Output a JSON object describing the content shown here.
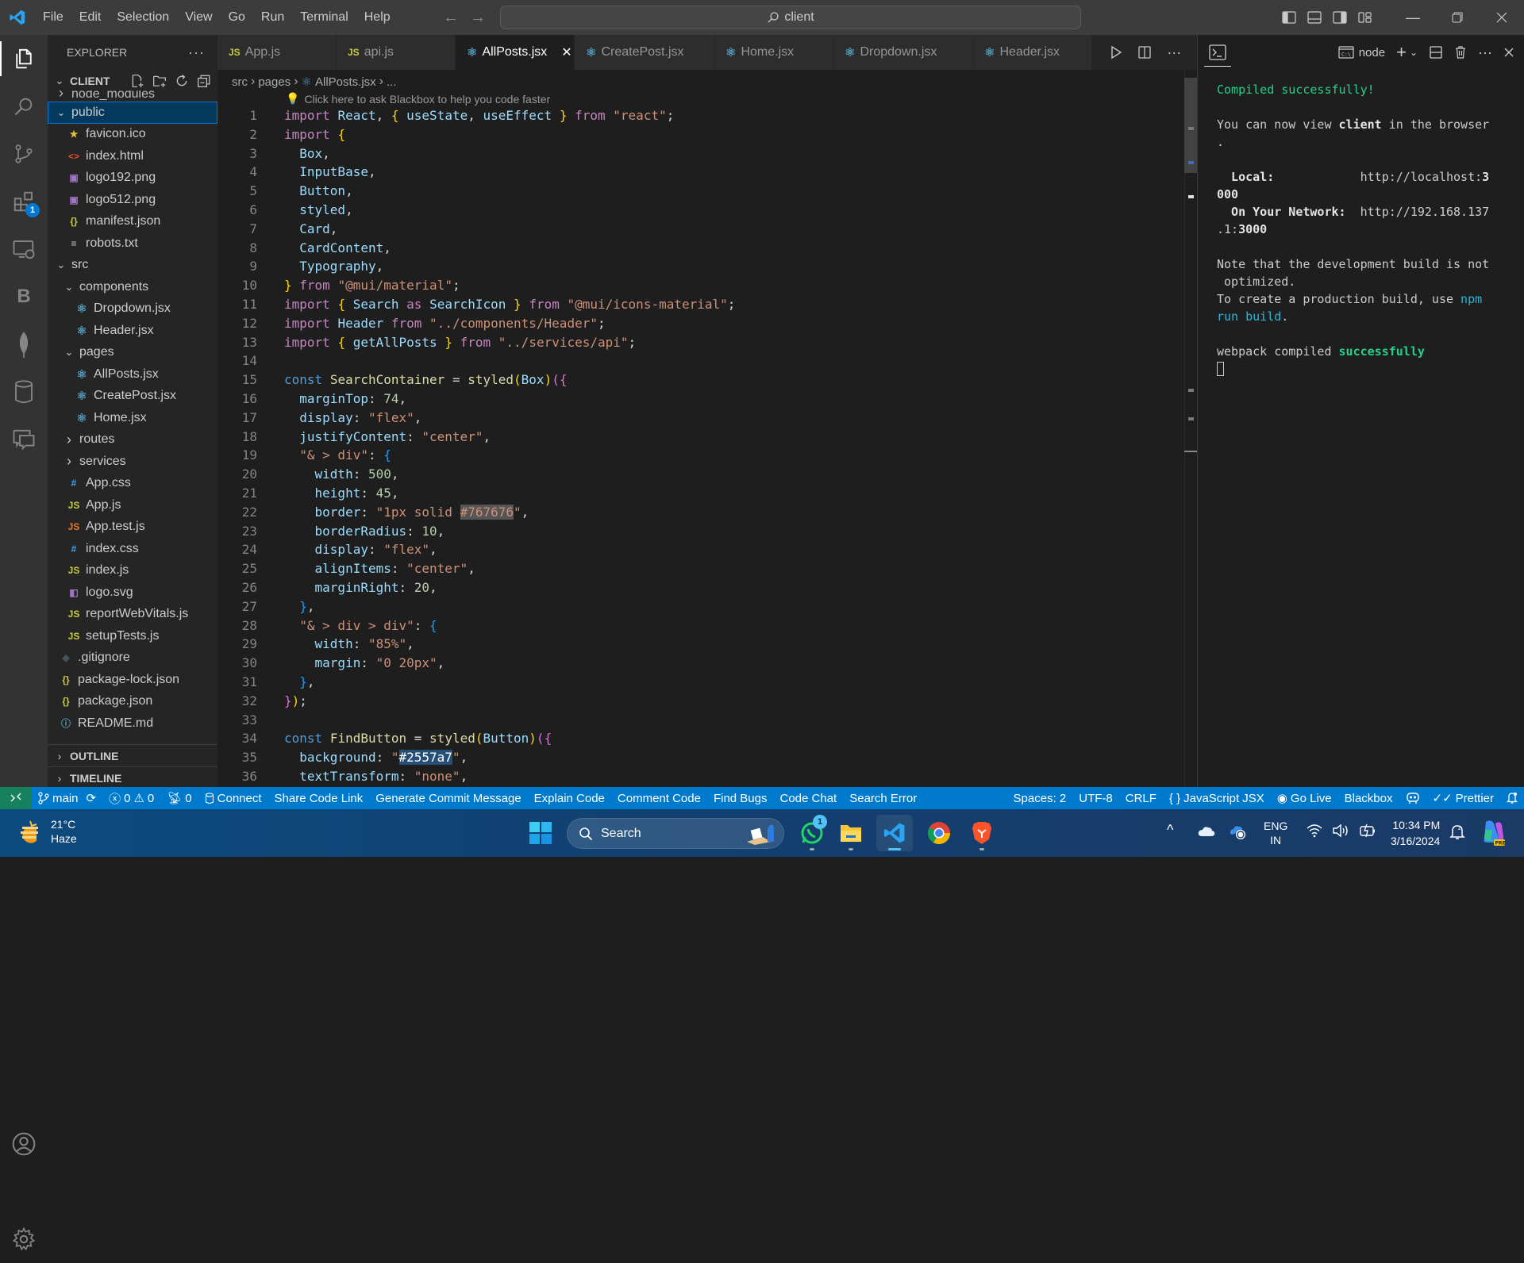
{
  "titlebar": {
    "menu": [
      "File",
      "Edit",
      "Selection",
      "View",
      "Go",
      "Run",
      "Terminal",
      "Help"
    ],
    "command_center": "client",
    "window_controls": [
      "minimize",
      "restore",
      "close"
    ]
  },
  "activity_bar": {
    "items": [
      {
        "name": "explorer",
        "active": true
      },
      {
        "name": "search"
      },
      {
        "name": "source-control"
      },
      {
        "name": "extensions",
        "badge": "1"
      },
      {
        "name": "remote-explorer"
      },
      {
        "name": "blackbox",
        "glyph": "B"
      },
      {
        "name": "mongodb"
      },
      {
        "name": "database"
      },
      {
        "name": "chat"
      }
    ],
    "bottom": [
      "accounts",
      "manage"
    ]
  },
  "sidebar": {
    "title": "EXPLORER",
    "section": "CLIENT",
    "tree": [
      {
        "label": "node_modules",
        "type": "folder",
        "depth": 1,
        "open": false,
        "cut": true
      },
      {
        "label": "public",
        "type": "folder",
        "depth": 1,
        "open": true,
        "selected": true
      },
      {
        "label": "favicon.ico",
        "type": "ico",
        "depth": 2
      },
      {
        "label": "index.html",
        "type": "html",
        "depth": 2
      },
      {
        "label": "logo192.png",
        "type": "png",
        "depth": 2
      },
      {
        "label": "logo512.png",
        "type": "png",
        "depth": 2
      },
      {
        "label": "manifest.json",
        "type": "json",
        "depth": 2
      },
      {
        "label": "robots.txt",
        "type": "txt",
        "depth": 2
      },
      {
        "label": "src",
        "type": "folder",
        "depth": 1,
        "open": true
      },
      {
        "label": "components",
        "type": "folder",
        "depth": 2,
        "open": true
      },
      {
        "label": "Dropdown.jsx",
        "type": "jsx",
        "depth": 3
      },
      {
        "label": "Header.jsx",
        "type": "jsx",
        "depth": 3
      },
      {
        "label": "pages",
        "type": "folder",
        "depth": 2,
        "open": true
      },
      {
        "label": "AllPosts.jsx",
        "type": "jsx",
        "depth": 3
      },
      {
        "label": "CreatePost.jsx",
        "type": "jsx",
        "depth": 3
      },
      {
        "label": "Home.jsx",
        "type": "jsx",
        "depth": 3
      },
      {
        "label": "routes",
        "type": "folder",
        "depth": 2,
        "open": false
      },
      {
        "label": "services",
        "type": "folder",
        "depth": 2,
        "open": false
      },
      {
        "label": "App.css",
        "type": "css",
        "depth": 2
      },
      {
        "label": "App.js",
        "type": "js",
        "depth": 2
      },
      {
        "label": "App.test.js",
        "type": "test",
        "depth": 2
      },
      {
        "label": "index.css",
        "type": "css",
        "depth": 2
      },
      {
        "label": "index.js",
        "type": "js",
        "depth": 2
      },
      {
        "label": "logo.svg",
        "type": "svg",
        "depth": 2
      },
      {
        "label": "reportWebVitals.js",
        "type": "js",
        "depth": 2
      },
      {
        "label": "setupTests.js",
        "type": "js",
        "depth": 2
      },
      {
        "label": ".gitignore",
        "type": "git",
        "depth": 1
      },
      {
        "label": "package-lock.json",
        "type": "json",
        "depth": 1
      },
      {
        "label": "package.json",
        "type": "json",
        "depth": 1
      },
      {
        "label": "README.md",
        "type": "info",
        "depth": 1
      }
    ],
    "outline": "OUTLINE",
    "timeline": "TIMELINE"
  },
  "editor": {
    "tabs": [
      {
        "label": "App.js",
        "type": "js"
      },
      {
        "label": "api.js",
        "type": "js"
      },
      {
        "label": "AllPosts.jsx",
        "type": "jsx",
        "active": true
      },
      {
        "label": "CreatePost.jsx",
        "type": "jsx"
      },
      {
        "label": "Home.jsx",
        "type": "jsx"
      },
      {
        "label": "Dropdown.jsx",
        "type": "jsx"
      },
      {
        "label": "Header.jsx",
        "type": "jsx"
      }
    ],
    "breadcrumb": [
      "src",
      "pages",
      "AllPosts.jsx",
      "..."
    ],
    "codelens": "Click here to ask Blackbox to help you code faster",
    "lines": [
      [
        [
          "kw",
          "import"
        ],
        [
          "pn",
          " "
        ],
        [
          "id",
          "React"
        ],
        [
          "pn",
          ", "
        ],
        [
          "b1",
          "{"
        ],
        [
          "pn",
          " "
        ],
        [
          "id",
          "useState"
        ],
        [
          "pn",
          ", "
        ],
        [
          "id",
          "useEffect"
        ],
        [
          "pn",
          " "
        ],
        [
          "b1",
          "}"
        ],
        [
          "pn",
          " "
        ],
        [
          "kw",
          "from"
        ],
        [
          "pn",
          " "
        ],
        [
          "st",
          "\"react\""
        ],
        [
          "pn",
          ";"
        ]
      ],
      [
        [
          "kw",
          "import"
        ],
        [
          "pn",
          " "
        ],
        [
          "b1",
          "{"
        ]
      ],
      [
        [
          "pn",
          "  "
        ],
        [
          "id",
          "Box"
        ],
        [
          "pn",
          ","
        ]
      ],
      [
        [
          "pn",
          "  "
        ],
        [
          "id",
          "InputBase"
        ],
        [
          "pn",
          ","
        ]
      ],
      [
        [
          "pn",
          "  "
        ],
        [
          "id",
          "Button"
        ],
        [
          "pn",
          ","
        ]
      ],
      [
        [
          "pn",
          "  "
        ],
        [
          "id",
          "styled"
        ],
        [
          "pn",
          ","
        ]
      ],
      [
        [
          "pn",
          "  "
        ],
        [
          "id",
          "Card"
        ],
        [
          "pn",
          ","
        ]
      ],
      [
        [
          "pn",
          "  "
        ],
        [
          "id",
          "CardContent"
        ],
        [
          "pn",
          ","
        ]
      ],
      [
        [
          "pn",
          "  "
        ],
        [
          "id",
          "Typography"
        ],
        [
          "pn",
          ","
        ]
      ],
      [
        [
          "b1",
          "}"
        ],
        [
          "pn",
          " "
        ],
        [
          "kw",
          "from"
        ],
        [
          "pn",
          " "
        ],
        [
          "st",
          "\"@mui/material\""
        ],
        [
          "pn",
          ";"
        ]
      ],
      [
        [
          "kw",
          "import"
        ],
        [
          "pn",
          " "
        ],
        [
          "b1",
          "{"
        ],
        [
          "pn",
          " "
        ],
        [
          "id",
          "Search"
        ],
        [
          "pn",
          " "
        ],
        [
          "kw",
          "as"
        ],
        [
          "pn",
          " "
        ],
        [
          "id",
          "SearchIcon"
        ],
        [
          "pn",
          " "
        ],
        [
          "b1",
          "}"
        ],
        [
          "pn",
          " "
        ],
        [
          "kw",
          "from"
        ],
        [
          "pn",
          " "
        ],
        [
          "st",
          "\"@mui/icons-material\""
        ],
        [
          "pn",
          ";"
        ]
      ],
      [
        [
          "kw",
          "import"
        ],
        [
          "pn",
          " "
        ],
        [
          "id",
          "Header"
        ],
        [
          "pn",
          " "
        ],
        [
          "kw",
          "from"
        ],
        [
          "pn",
          " "
        ],
        [
          "st",
          "\"../components/Header\""
        ],
        [
          "pn",
          ";"
        ]
      ],
      [
        [
          "kw",
          "import"
        ],
        [
          "pn",
          " "
        ],
        [
          "b1",
          "{"
        ],
        [
          "pn",
          " "
        ],
        [
          "id",
          "getAllPosts"
        ],
        [
          "pn",
          " "
        ],
        [
          "b1",
          "}"
        ],
        [
          "pn",
          " "
        ],
        [
          "kw",
          "from"
        ],
        [
          "pn",
          " "
        ],
        [
          "st",
          "\"../services/api\""
        ],
        [
          "pn",
          ";"
        ]
      ],
      [],
      [
        [
          "kb",
          "const"
        ],
        [
          "pn",
          " "
        ],
        [
          "fn",
          "SearchContainer"
        ],
        [
          "pn",
          " = "
        ],
        [
          "fn",
          "styled"
        ],
        [
          "b1",
          "("
        ],
        [
          "id",
          "Box"
        ],
        [
          "b1",
          ")"
        ],
        [
          "b2",
          "("
        ],
        [
          "b2",
          "{"
        ]
      ],
      [
        [
          "pn",
          "  "
        ],
        [
          "id",
          "marginTop"
        ],
        [
          "pn",
          ": "
        ],
        [
          "nm",
          "74"
        ],
        [
          "pn",
          ","
        ]
      ],
      [
        [
          "pn",
          "  "
        ],
        [
          "id",
          "display"
        ],
        [
          "pn",
          ": "
        ],
        [
          "st",
          "\"flex\""
        ],
        [
          "pn",
          ","
        ]
      ],
      [
        [
          "pn",
          "  "
        ],
        [
          "id",
          "justifyContent"
        ],
        [
          "pn",
          ": "
        ],
        [
          "st",
          "\"center\""
        ],
        [
          "pn",
          ","
        ]
      ],
      [
        [
          "pn",
          "  "
        ],
        [
          "st",
          "\"& > div\""
        ],
        [
          "pn",
          ": "
        ],
        [
          "b3",
          "{"
        ]
      ],
      [
        [
          "pn",
          "    "
        ],
        [
          "id",
          "width"
        ],
        [
          "pn",
          ": "
        ],
        [
          "nm",
          "500"
        ],
        [
          "pn",
          ","
        ]
      ],
      [
        [
          "pn",
          "    "
        ],
        [
          "id",
          "height"
        ],
        [
          "pn",
          ": "
        ],
        [
          "nm",
          "45"
        ],
        [
          "pn",
          ","
        ]
      ],
      [
        [
          "pn",
          "    "
        ],
        [
          "id",
          "border"
        ],
        [
          "pn",
          ": "
        ],
        [
          "st",
          "\"1px solid "
        ],
        [
          "st hl-gray",
          "#767676"
        ],
        [
          "st",
          "\""
        ],
        [
          "pn",
          ","
        ]
      ],
      [
        [
          "pn",
          "    "
        ],
        [
          "id",
          "borderRadius"
        ],
        [
          "pn",
          ": "
        ],
        [
          "nm",
          "10"
        ],
        [
          "pn",
          ","
        ]
      ],
      [
        [
          "pn",
          "    "
        ],
        [
          "id",
          "display"
        ],
        [
          "pn",
          ": "
        ],
        [
          "st",
          "\"flex\""
        ],
        [
          "pn",
          ","
        ]
      ],
      [
        [
          "pn",
          "    "
        ],
        [
          "id",
          "alignItems"
        ],
        [
          "pn",
          ": "
        ],
        [
          "st",
          "\"center\""
        ],
        [
          "pn",
          ","
        ]
      ],
      [
        [
          "pn",
          "    "
        ],
        [
          "id",
          "marginRight"
        ],
        [
          "pn",
          ": "
        ],
        [
          "nm",
          "20"
        ],
        [
          "pn",
          ","
        ]
      ],
      [
        [
          "pn",
          "  "
        ],
        [
          "b3",
          "}"
        ],
        [
          "pn",
          ","
        ]
      ],
      [
        [
          "pn",
          "  "
        ],
        [
          "st",
          "\"& > div > div\""
        ],
        [
          "pn",
          ": "
        ],
        [
          "b3",
          "{"
        ]
      ],
      [
        [
          "pn",
          "    "
        ],
        [
          "id",
          "width"
        ],
        [
          "pn",
          ": "
        ],
        [
          "st",
          "\"85%\""
        ],
        [
          "pn",
          ","
        ]
      ],
      [
        [
          "pn",
          "    "
        ],
        [
          "id",
          "margin"
        ],
        [
          "pn",
          ": "
        ],
        [
          "st",
          "\"0 20px\""
        ],
        [
          "pn",
          ","
        ]
      ],
      [
        [
          "pn",
          "  "
        ],
        [
          "b3",
          "}"
        ],
        [
          "pn",
          ","
        ]
      ],
      [
        [
          "b2",
          "}"
        ],
        [
          "b1",
          ")"
        ],
        [
          "pn",
          ";"
        ]
      ],
      [],
      [
        [
          "kb",
          "const"
        ],
        [
          "pn",
          " "
        ],
        [
          "fn",
          "FindButton"
        ],
        [
          "pn",
          " = "
        ],
        [
          "fn",
          "styled"
        ],
        [
          "b1",
          "("
        ],
        [
          "id",
          "Button"
        ],
        [
          "b1",
          ")"
        ],
        [
          "b2",
          "("
        ],
        [
          "b2",
          "{"
        ]
      ],
      [
        [
          "pn",
          "  "
        ],
        [
          "id",
          "background"
        ],
        [
          "pn",
          ": "
        ],
        [
          "st",
          "\""
        ],
        [
          "hl-sel",
          "#2557a7"
        ],
        [
          "st",
          "\""
        ],
        [
          "pn",
          ","
        ]
      ],
      [
        [
          "pn",
          "  "
        ],
        [
          "id",
          "textTransform"
        ],
        [
          "pn",
          ": "
        ],
        [
          "st",
          "\"none\""
        ],
        [
          "pn",
          ","
        ]
      ]
    ]
  },
  "terminal": {
    "shell_label": "node",
    "output": [
      [
        [
          "t-green",
          "Compiled successfully!"
        ]
      ],
      [],
      [
        [
          "",
          "You can now view "
        ],
        [
          "t-bold",
          "client"
        ],
        [
          "",
          " in the browser"
        ]
      ],
      [
        [
          "",
          "."
        ]
      ],
      [],
      [
        [
          "t-bold",
          "  Local:"
        ],
        [
          "",
          "            http://localhost:"
        ],
        [
          "t-bold",
          "3"
        ]
      ],
      [
        [
          "t-bold",
          "000"
        ]
      ],
      [
        [
          "t-bold",
          "  On Your Network:"
        ],
        [
          "",
          "  http://192.168.137"
        ]
      ],
      [
        [
          "",
          ".1:"
        ],
        [
          "t-bold",
          "3000"
        ]
      ],
      [],
      [
        [
          "",
          "Note that the development build is not"
        ]
      ],
      [
        [
          "",
          " optimized."
        ]
      ],
      [
        [
          "",
          "To create a production build, use "
        ],
        [
          "t-blue",
          "npm"
        ]
      ],
      [
        [
          "t-blue",
          "run build"
        ],
        [
          "",
          "."
        ]
      ],
      [],
      [
        [
          "",
          "webpack compiled "
        ],
        [
          "t-boldgreen",
          "successfully"
        ]
      ]
    ]
  },
  "statusbar": {
    "branch": "main",
    "errors": "0",
    "warnings": "0",
    "ports": "0",
    "items_left": [
      "Connect",
      "Share Code Link",
      "Generate Commit Message",
      "Explain Code",
      "Comment Code",
      "Find Bugs",
      "Code Chat",
      "Search Error"
    ],
    "spaces": "Spaces: 2",
    "encoding": "UTF-8",
    "eol": "CRLF",
    "language": "JavaScript JSX",
    "go_live": "Go Live",
    "blackbox": "Blackbox",
    "prettier": "Prettier"
  },
  "taskbar": {
    "weather_temp": "21°C",
    "weather_desc": "Haze",
    "search_placeholder": "Search",
    "apps": [
      {
        "name": "whatsapp",
        "badge": "1"
      },
      {
        "name": "file-explorer"
      },
      {
        "name": "vscode",
        "active": true
      },
      {
        "name": "chrome"
      },
      {
        "name": "brave"
      }
    ],
    "lang_top": "ENG",
    "lang_bottom": "IN",
    "time": "10:34 PM",
    "date": "3/16/2024"
  },
  "colors": {
    "accent": "#007acc",
    "remote": "#16825d",
    "selection": "#04395e"
  }
}
